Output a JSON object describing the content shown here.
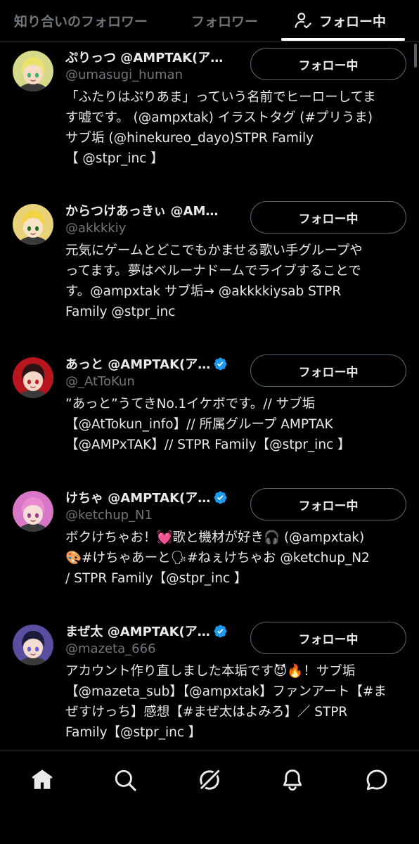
{
  "tabs": [
    {
      "label": "知り合いのフォロワー",
      "active": false
    },
    {
      "label": "フォロワー",
      "active": false
    },
    {
      "label": "フォロー中",
      "active": true,
      "icon": "person-check-icon"
    }
  ],
  "users": [
    {
      "name": "ぷりっつ @AMPTAK(ア…",
      "handle": "@umasugi_human",
      "verified": false,
      "button": "フォロー中",
      "bio_lines": [
        "「ふたりはぷりあま」っていう名前でヒーローしてま",
        "す嘘です。 (@ampxtak) イラストタグ (#プリうま)",
        "サブ垢 (@hinekureo_dayo)STPR Family",
        "【 @stpr_inc 】"
      ]
    },
    {
      "name": "からつけあっきぃ @AM…",
      "handle": "@akkkkiy",
      "verified": false,
      "button": "フォロー中",
      "bio_lines": [
        "元気にゲームとどこでもかませる歌い手グループや",
        "ってます。夢はベルーナドームでライブすることで",
        "す。@ampxtak サブ垢→ @akkkkiysab STPR",
        "Family @stpr_inc"
      ]
    },
    {
      "name": "あっと @AMPTAK(ア…",
      "handle": "@_AtToKun",
      "verified": true,
      "button": "フォロー中",
      "bio_lines": [
        "”あっと”うてきNo.1イケボです。// サブ垢",
        "【@AtTokun_info】// 所属グループ AMPTAK",
        "【@AMPxTAK】// STPR Family【@stpr_inc 】"
      ]
    },
    {
      "name": "けちゃ @AMPTAK(ア…",
      "handle": "@ketchup_N1",
      "verified": true,
      "button": "フォロー中",
      "bio_lines": [
        "ボクけちゃお！💓歌と機材が好き🎧 (@ampxtak)",
        "🎨#けちゃあーと🗣#ねぇけちゃお @ketchup_N2",
        "/ STPR Family【@stpr_inc 】"
      ]
    },
    {
      "name": "まぜ太 @AMPTAK(ア…",
      "handle": "@mazeta_666",
      "verified": true,
      "button": "フォロー中",
      "bio_lines": [
        "アカウント作り直しました本垢です😈🔥！サブ垢",
        "【@mazeta_sub】【@ampxtak】ファンアート【#ま",
        "ぜすけっち】感想【#まぜ太はよみろ】／ STPR",
        "Family【@stpr_inc 】"
      ]
    }
  ],
  "avatars": [
    {
      "name": "avatar-prittsu",
      "bg": "#d6d98a",
      "hair": "#e8e36a",
      "skin": "#f6dcc4",
      "eye": "#3fb36a"
    },
    {
      "name": "avatar-akkiy",
      "bg": "#e9d37a",
      "hair": "#f2d348",
      "skin": "#f8e2c8",
      "eye": "#2d6a2d"
    },
    {
      "name": "avatar-atto",
      "bg": "#b8161e",
      "hair": "#2a1416",
      "skin": "#f3d7c8",
      "eye": "#c02028"
    },
    {
      "name": "avatar-ketchup",
      "bg": "#d877c8",
      "hair": "#ec8ad0",
      "skin": "#f7dfd8",
      "eye": "#a03d8a"
    },
    {
      "name": "avatar-mazeta",
      "bg": "#5a4ea0",
      "hair": "#1a1c3a",
      "skin": "#f3dcd0",
      "eye": "#6b5ad0"
    }
  ],
  "bottom_nav": [
    {
      "name": "home-icon"
    },
    {
      "name": "search-icon"
    },
    {
      "name": "grok-icon"
    },
    {
      "name": "bell-icon"
    },
    {
      "name": "messages-icon"
    }
  ],
  "colors": {
    "verified": "#1d9bf0",
    "muted": "#71767b",
    "text": "#e7e9ea",
    "border": "#536471"
  }
}
